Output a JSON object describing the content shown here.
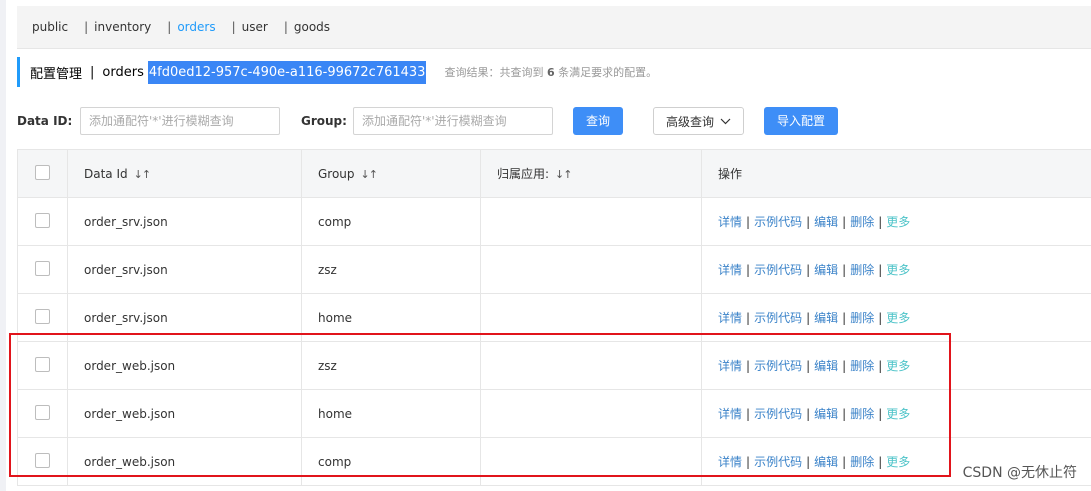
{
  "namespaces": [
    {
      "label": "public",
      "sep": "",
      "active": false
    },
    {
      "label": "inventory",
      "sep": "|",
      "active": false
    },
    {
      "label": "orders",
      "sep": "|",
      "active": true
    },
    {
      "label": "user",
      "sep": "|",
      "active": false
    },
    {
      "label": "goods",
      "sep": "|",
      "active": false
    }
  ],
  "header": {
    "title": "配置管理",
    "separator": "|",
    "tenant": "orders",
    "namespace_id": "4fd0ed12-957c-490e-a116-99672c761433",
    "result_prefix": "查询结果：共查询到",
    "result_count": "6",
    "result_suffix": "条满足要求的配置。"
  },
  "search": {
    "data_id_label": "Data ID:",
    "data_id_placeholder": "添加通配符'*'进行模糊查询",
    "group_label": "Group:",
    "group_placeholder": "添加通配符'*'进行模糊查询",
    "query_button": "查询",
    "advanced_button": "高级查询",
    "import_button": "导入配置"
  },
  "table": {
    "columns": [
      "Data Id",
      "Group",
      "归属应用:",
      "操作"
    ],
    "actions": [
      "详情",
      "示例代码",
      "编辑",
      "删除",
      "更多"
    ],
    "rows": [
      {
        "data_id": "order_srv.json",
        "group": "comp",
        "app": ""
      },
      {
        "data_id": "order_srv.json",
        "group": "zsz",
        "app": ""
      },
      {
        "data_id": "order_srv.json",
        "group": "home",
        "app": ""
      },
      {
        "data_id": "order_web.json",
        "group": "zsz",
        "app": ""
      },
      {
        "data_id": "order_web.json",
        "group": "home",
        "app": ""
      },
      {
        "data_id": "order_web.json",
        "group": "comp",
        "app": ""
      }
    ]
  },
  "icons": {
    "sort": "sort-icon",
    "chevron": "chevron-down-icon",
    "checkbox": "checkbox-icon"
  },
  "colors": {
    "primary": "#3e8ef7",
    "active_tab": "#209bfa",
    "link": "#3b83c9",
    "more_link": "#4cc3c8",
    "annotation": "#e1141b"
  },
  "watermark": "CSDN @无休止符"
}
